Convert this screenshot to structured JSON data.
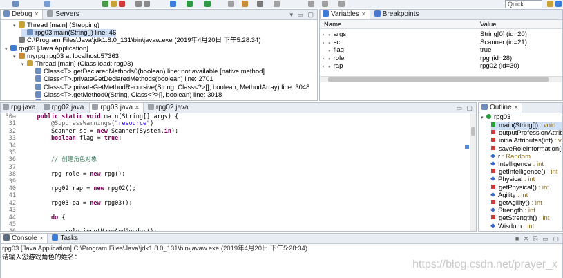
{
  "toolbar": {
    "quick_access": "Quick Access"
  },
  "debug": {
    "tabs": [
      {
        "label": "Debug"
      },
      {
        "label": "Servers"
      }
    ],
    "tree": [
      {
        "indent": 1,
        "arrow": "▾",
        "label": "Thread [main] (Stepping)",
        "icon": "thread-icon"
      },
      {
        "indent": 2,
        "arrow": "",
        "label": "rpg03.main(String[]) line: 46",
        "icon": "stack-frame-icon",
        "selected": true
      },
      {
        "indent": 1,
        "arrow": "",
        "label": "C:\\Program Files\\Java\\jdk1.8.0_131\\bin\\javaw.exe (2019年4月20日 下午5:28:34)",
        "icon": "process-icon"
      },
      {
        "indent": 0,
        "arrow": "▾",
        "label": "rpg03 [Java Application]",
        "icon": "java-app-icon"
      },
      {
        "indent": 1,
        "arrow": "▾",
        "label": "myrpg.rpg03 at localhost:57363",
        "icon": "debug-target-icon"
      },
      {
        "indent": 2,
        "arrow": "▾",
        "label": "Thread [main] (Class load: rpg03)",
        "icon": "thread-icon"
      },
      {
        "indent": 3,
        "arrow": "",
        "label": "Class<T>.getDeclaredMethods0(boolean) line: not available [native method]",
        "icon": "stack-frame-icon"
      },
      {
        "indent": 3,
        "arrow": "",
        "label": "Class<T>.privateGetDeclaredMethods(boolean) line: 2701",
        "icon": "stack-frame-icon"
      },
      {
        "indent": 3,
        "arrow": "",
        "label": "Class<T>.privateGetMethodRecursive(String, Class<?>[], boolean, MethodArray) line: 3048",
        "icon": "stack-frame-icon"
      },
      {
        "indent": 3,
        "arrow": "",
        "label": "Class<T>.getMethod0(String, Class<?>[], boolean) line: 3018",
        "icon": "stack-frame-icon"
      },
      {
        "indent": 3,
        "arrow": "",
        "label": "Class<T>.getMethod(String, Class<?>...) line: 1784",
        "icon": "stack-frame-icon"
      }
    ]
  },
  "variables": {
    "tabs": [
      {
        "label": "Variables"
      },
      {
        "label": "Breakpoints"
      }
    ],
    "headers": {
      "name": "Name",
      "value": "Value"
    },
    "rows": [
      {
        "name": "args",
        "value": "String[0]  (id=20)",
        "expand": true
      },
      {
        "name": "sc",
        "value": "Scanner  (id=21)",
        "expand": true
      },
      {
        "name": "flag",
        "value": "true",
        "expand": false
      },
      {
        "name": "role",
        "value": "rpg  (id=28)",
        "expand": true
      },
      {
        "name": "rap",
        "value": "rpg02  (id=30)",
        "expand": true
      }
    ]
  },
  "editor": {
    "tabs": [
      {
        "label": "rpg.java"
      },
      {
        "label": "rpg02.java"
      },
      {
        "label": "rpg03.java"
      },
      {
        "label": "rpg02.java"
      }
    ],
    "lines": [
      {
        "n": "30⊖",
        "html": "    <span class='kw'>public static void</span> main(String[] args) {"
      },
      {
        "n": "31",
        "html": "        <span class='ann'>@SuppressWarnings</span>(<span class='str'>\"resource\"</span>)"
      },
      {
        "n": "32",
        "html": "        Scanner sc = <span class='kw'>new</span> Scanner(System.<span class='kw'>in</span>);"
      },
      {
        "n": "33",
        "html": "        <span class='kw'>boolean</span> flag = <span class='kw'>true</span>;"
      },
      {
        "n": "34",
        "html": ""
      },
      {
        "n": "35",
        "html": ""
      },
      {
        "n": "36",
        "html": "        <span class='cmt'>// 创建角色对象</span>"
      },
      {
        "n": "37",
        "html": ""
      },
      {
        "n": "38",
        "html": "        rpg role = <span class='kw'>new</span> rpg();"
      },
      {
        "n": "39",
        "html": ""
      },
      {
        "n": "40",
        "html": "        rpg02 rap = <span class='kw'>new</span> rpg02();"
      },
      {
        "n": "41",
        "html": ""
      },
      {
        "n": "42",
        "html": "        rpg03 pa = <span class='kw'>new</span> rpg03();"
      },
      {
        "n": "43",
        "html": ""
      },
      {
        "n": "44",
        "html": "        <span class='kw'>do</span> {"
      },
      {
        "n": "45",
        "html": ""
      },
      {
        "n": "46",
        "html": "            role.inputNameAndGender();"
      }
    ]
  },
  "outline": {
    "tab": "Outline",
    "root": "rpg03",
    "items": [
      {
        "label": "main(String[]) : void",
        "kind": "method-static",
        "selected": true
      },
      {
        "label": "outputProfessionAttrib",
        "kind": "method"
      },
      {
        "label": "initialAttributes(int) : v",
        "kind": "method"
      },
      {
        "label": "saveRoleInformation(rp",
        "kind": "method"
      },
      {
        "label": "r : Random",
        "kind": "field"
      },
      {
        "label": "Intelligence : int",
        "kind": "field"
      },
      {
        "label": "getIntelligence() : int",
        "kind": "method"
      },
      {
        "label": "Physical : int",
        "kind": "field"
      },
      {
        "label": "getPhysical() : int",
        "kind": "method"
      },
      {
        "label": "Agility : int",
        "kind": "field"
      },
      {
        "label": "getAgility() : int",
        "kind": "method"
      },
      {
        "label": "Strength : int",
        "kind": "field"
      },
      {
        "label": "getStrength() : int",
        "kind": "method"
      },
      {
        "label": "Wisdom : int",
        "kind": "field"
      }
    ]
  },
  "console": {
    "tabs": [
      {
        "label": "Console"
      },
      {
        "label": "Tasks"
      }
    ],
    "header": "rpg03 [Java Application] C:\\Program Files\\Java\\jdk1.8.0_131\\bin\\javaw.exe (2019年4月20日 下午5:28:34)",
    "output": "请输入您游戏角色的姓名："
  },
  "watermark": "https://blog.csdn.net/prayer_x",
  "colors": {
    "accent": "#cfe0f6",
    "method_green": "#2e9a45",
    "method_red": "#d03a3a",
    "field_blue": "#3a66c8"
  }
}
